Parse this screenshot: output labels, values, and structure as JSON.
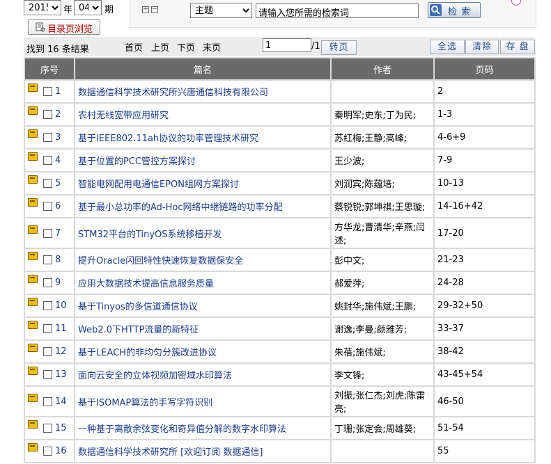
{
  "filter": {
    "year": "2015",
    "year_suffix": "年",
    "issue": "04",
    "issue_suffix": "期",
    "toc_button": "目录页浏览"
  },
  "search": {
    "field": "主题",
    "query": "请输入您所需的检索词",
    "button": "检 索"
  },
  "toolbar": {
    "result_count": "找到 16 条结果",
    "first": "首页",
    "prev": "上页",
    "next": "下页",
    "last": "末页",
    "page_input": "1",
    "page_total": "/1",
    "goto": "转页",
    "select_all": "全选",
    "clear": "清除",
    "save": "存 盘"
  },
  "table": {
    "headers": [
      "序号",
      "篇名",
      "作者",
      "页码"
    ],
    "rows": [
      {
        "no": "1",
        "title": "数据通信科学技术研究所兴唐通信科技有限公司",
        "author": "",
        "pages": "2"
      },
      {
        "no": "2",
        "title": "农村无线宽带应用研究",
        "author": "秦明军;史东;丁为民;",
        "pages": "1-3"
      },
      {
        "no": "3",
        "title": "基于IEEE802.11ah协议的功率管理技术研究",
        "author": "苏红梅;王静;高峰;",
        "pages": "4-6+9"
      },
      {
        "no": "4",
        "title": "基于位置的PCC管控方案探讨",
        "author": "王少波;",
        "pages": "7-9"
      },
      {
        "no": "5",
        "title": "智能电网配用电通信EPON组网方案探讨",
        "author": "刘润宾;陈蕴培;",
        "pages": "10-13"
      },
      {
        "no": "6",
        "title": "基于最小总功率的Ad-Hoc网络中继链路的功率分配",
        "author": "蔡锐锐;郭坤祺;王思璇;",
        "pages": "14-16+42"
      },
      {
        "no": "7",
        "title": "STM32平台的TinyOS系统移植开发",
        "author": "方华龙;曹清华;辛燕;闫述;",
        "pages": "17-20"
      },
      {
        "no": "8",
        "title": "提升Oracle闪回特性快速恢复数据保安全",
        "author": "彭中文;",
        "pages": "21-23"
      },
      {
        "no": "9",
        "title": "应用大数据技术提高信息服务质量",
        "author": "郝爱萍;",
        "pages": "24-28"
      },
      {
        "no": "10",
        "title": "基于Tinyos的多信道通信协议",
        "author": "姚封华;施伟斌;王鹏;",
        "pages": "29-32+50"
      },
      {
        "no": "11",
        "title": "Web2.0下HTTP流量的新特征",
        "author": "谢逸;李曼;颜雅芳;",
        "pages": "33-37"
      },
      {
        "no": "12",
        "title": "基于LEACH的非均匀分簇改进协议",
        "author": "朱蓓;施伟斌;",
        "pages": "38-42"
      },
      {
        "no": "13",
        "title": "面向云安全的立体视频加密域水印算法",
        "author": "李文锋;",
        "pages": "43-45+54"
      },
      {
        "no": "14",
        "title": "基于ISOMAP算法的手写字符识别",
        "author": "刘振;张仁杰;刘虎;陈雷亮;",
        "pages": "46-50"
      },
      {
        "no": "15",
        "title": "一种基于离散余弦变化和奇异值分解的数字水印算法",
        "author": "丁珊;张定会;周雄葵;",
        "pages": "51-54"
      },
      {
        "no": "16",
        "title": "数据通信科学技术研究所 [欢迎订阅 数据通信]",
        "author": "",
        "pages": "55"
      }
    ]
  }
}
